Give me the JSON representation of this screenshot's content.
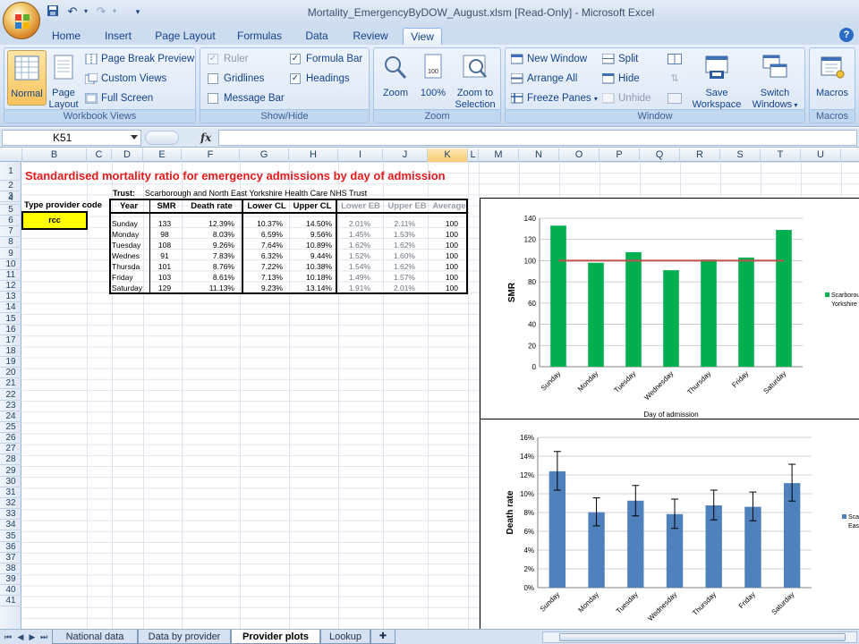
{
  "window": {
    "title": "Mortality_EmergencyByDOW_August.xlsm  [Read-Only]  -  Microsoft Excel"
  },
  "qat": {
    "save_icon": "save-icon",
    "undo_icon": "undo-icon",
    "redo_icon": "redo-icon",
    "customize_icon": "customize-qat-icon"
  },
  "ribbon": {
    "tabs": [
      "Home",
      "Insert",
      "Page Layout",
      "Formulas",
      "Data",
      "Review",
      "View"
    ],
    "active_tab": "View",
    "groups": {
      "workbook_views": {
        "label": "Workbook Views",
        "normal": "Normal",
        "page_layout_1": "Page",
        "page_layout_2": "Layout",
        "page_break_preview": "Page Break Preview",
        "custom_views": "Custom Views",
        "full_screen": "Full Screen"
      },
      "show_hide": {
        "label": "Show/Hide",
        "ruler": "Ruler",
        "ruler_checked": true,
        "gridlines": "Gridlines",
        "gridlines_checked": false,
        "message_bar": "Message Bar",
        "message_bar_checked": false,
        "formula_bar": "Formula Bar",
        "formula_bar_checked": true,
        "headings": "Headings",
        "headings_checked": true
      },
      "zoom": {
        "label": "Zoom",
        "zoom": "Zoom",
        "hundred": "100%",
        "zoom_to_selection_1": "Zoom to",
        "zoom_to_selection_2": "Selection"
      },
      "window": {
        "label": "Window",
        "new_window": "New Window",
        "arrange_all": "Arrange All",
        "freeze_panes": "Freeze Panes",
        "split": "Split",
        "hide": "Hide",
        "unhide": "Unhide",
        "save_workspace_1": "Save",
        "save_workspace_2": "Workspace",
        "switch_windows_1": "Switch",
        "switch_windows_2": "Windows"
      },
      "macros": {
        "label": "Macros",
        "macros": "Macros"
      }
    }
  },
  "formula_bar": {
    "name_box": "K51",
    "fx": "fx",
    "content": ""
  },
  "grid": {
    "columns": [
      "B",
      "C",
      "D",
      "E",
      "F",
      "G",
      "H",
      "I",
      "J",
      "K",
      "L",
      "M",
      "N",
      "O",
      "P",
      "Q",
      "R",
      "S",
      "T",
      "U"
    ],
    "selected_column": "K",
    "rows": [
      "1",
      "2",
      "3",
      "4",
      "5",
      "6",
      "7",
      "8",
      "9",
      "10",
      "11",
      "12",
      "13",
      "14",
      "15",
      "16",
      "17",
      "18",
      "19",
      "20",
      "21",
      "22",
      "23",
      "24",
      "25",
      "26",
      "27",
      "28",
      "29",
      "30",
      "31",
      "32",
      "33",
      "34",
      "35",
      "36",
      "37",
      "38",
      "39",
      "40",
      "41"
    ],
    "selected_row": "",
    "title": "Standardised mortality ratio for emergency admissions by day of admission",
    "trust_label": "Trust:",
    "trust_name": "Scarborough and North East Yorkshire Health Care NHS Trust",
    "provider_label": "Type provider code",
    "provider_code": "rcc",
    "table": {
      "headers": [
        "Year",
        "SMR",
        "Death rate",
        "Lower CL",
        "Upper CL",
        "Lower EB",
        "Upper EB",
        "Average"
      ],
      "rows": [
        [
          "Sunday",
          "133",
          "12.39%",
          "10.37%",
          "14.50%",
          "2.01%",
          "2.11%",
          "100"
        ],
        [
          "Monday",
          "98",
          "8.03%",
          "6.59%",
          "9.56%",
          "1.45%",
          "1.53%",
          "100"
        ],
        [
          "Tuesday",
          "108",
          "9.26%",
          "7.64%",
          "10.89%",
          "1.62%",
          "1.62%",
          "100"
        ],
        [
          "Wednes",
          "91",
          "7.83%",
          "6.32%",
          "9.44%",
          "1.52%",
          "1.60%",
          "100"
        ],
        [
          "Thursda",
          "101",
          "8.76%",
          "7.22%",
          "10.38%",
          "1.54%",
          "1.62%",
          "100"
        ],
        [
          "Friday",
          "103",
          "8.61%",
          "7.13%",
          "10.18%",
          "1.49%",
          "1.57%",
          "100"
        ],
        [
          "Saturday",
          "129",
          "11.13%",
          "9.23%",
          "13.14%",
          "1.91%",
          "2.01%",
          "100"
        ]
      ]
    }
  },
  "chart_data": [
    {
      "type": "bar",
      "categories": [
        "Sunday",
        "Monday",
        "Tuesday",
        "Wednesday",
        "Thursday",
        "Friday",
        "Saturday"
      ],
      "series": [
        {
          "name": "Scarborough and North East Yorkshire Health Care NHS Trust",
          "values": [
            133,
            98,
            108,
            91,
            101,
            103,
            129
          ],
          "color": "#00b050"
        },
        {
          "name": "",
          "type": "line",
          "values": [
            100,
            100,
            100,
            100,
            100,
            100,
            100
          ],
          "color": "#c0504d"
        }
      ],
      "title": "",
      "xlabel": "Day of admission",
      "ylabel": "SMR",
      "ylim": [
        0,
        140
      ],
      "yticks": [
        "0",
        "20",
        "40",
        "60",
        "80",
        "100",
        "120",
        "140"
      ],
      "grid": true,
      "legend_text": [
        "Scarborough",
        "Yorkshire"
      ],
      "legend": "right"
    },
    {
      "type": "bar",
      "categories": [
        "Sunday",
        "Monday",
        "Tuesday",
        "Wednesday",
        "Thursday",
        "Friday",
        "Saturday"
      ],
      "series": [
        {
          "name": "Scarborough and North East Yorkshire Health Care NHS Trust",
          "values": [
            12.39,
            8.03,
            9.26,
            7.83,
            8.76,
            8.61,
            11.13
          ],
          "color": "#4f81bd",
          "error_minus": [
            2.01,
            1.45,
            1.62,
            1.52,
            1.54,
            1.49,
            1.91
          ],
          "error_plus": [
            2.11,
            1.53,
            1.62,
            1.6,
            1.62,
            1.57,
            2.01
          ]
        }
      ],
      "title": "",
      "xlabel": "",
      "ylabel": "Death rate",
      "ylim": [
        0,
        16
      ],
      "yticks": [
        "0%",
        "2%",
        "4%",
        "6%",
        "8%",
        "10%",
        "12%",
        "14%",
        "16%"
      ],
      "grid": true,
      "legend_text": [
        "Scar",
        "East"
      ],
      "legend": "right"
    }
  ],
  "sheets": {
    "tabs": [
      "National data",
      "Data by provider",
      "Provider plots",
      "Lookup"
    ],
    "active": "Provider plots",
    "tab_colors": [
      "#92d050",
      "#92d050",
      "#ff0000",
      "#ffffff"
    ]
  }
}
